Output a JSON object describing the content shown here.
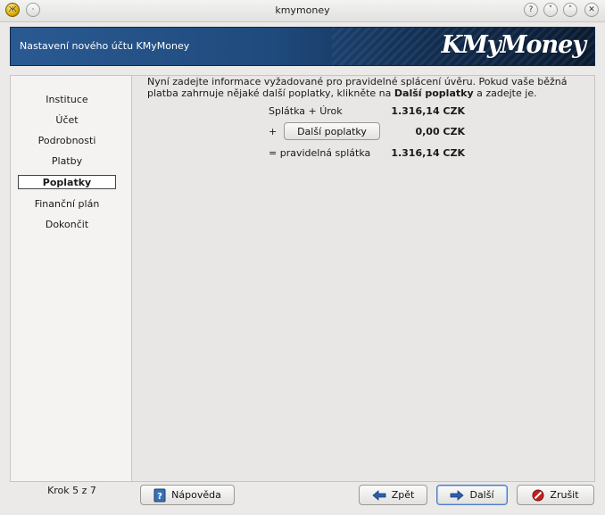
{
  "window": {
    "title": "kmymoney",
    "app_icon": "Ж",
    "pin_icon": "·",
    "help_icon": "?",
    "minimize_icon": "˅",
    "maximize_icon": "˄",
    "close_icon": "✕"
  },
  "banner": {
    "title": "Nastavení nového účtu KMyMoney",
    "logo": "KMyMoney"
  },
  "sidebar": {
    "steps": [
      {
        "label": "Instituce"
      },
      {
        "label": "Účet"
      },
      {
        "label": "Podrobnosti"
      },
      {
        "label": "Platby"
      },
      {
        "label": "Poplatky"
      },
      {
        "label": "Finanční plán"
      },
      {
        "label": "Dokončit"
      }
    ],
    "active_step": "Poplatky",
    "step_counter": "Krok 5 z 7"
  },
  "content": {
    "info_part1": "Nyní zadejte informace vyžadované pro pravidelné splácení úvěru. Pokud vaše běžná platba zahrnuje nějaké další poplatky, klikněte na ",
    "info_bold": "Další poplatky",
    "info_part2": " a zadejte je.",
    "rows": {
      "principal_label": "Splátka + Úrok",
      "principal_value": "1.316,14 CZK",
      "plus_sign": "+",
      "fees_button": "Další poplatky",
      "fees_value": "0,00 CZK",
      "total_label": "= pravidelná splátka",
      "total_value": "1.316,14 CZK"
    }
  },
  "footer": {
    "help": "Nápověda",
    "back": "Zpět",
    "next": "Další",
    "cancel": "Zrušit"
  },
  "colors": {
    "banner_start": "#2a5a92",
    "banner_end": "#0a1a30",
    "cancel_icon": "#c42020",
    "arrow_icon": "#2a5fb0"
  }
}
